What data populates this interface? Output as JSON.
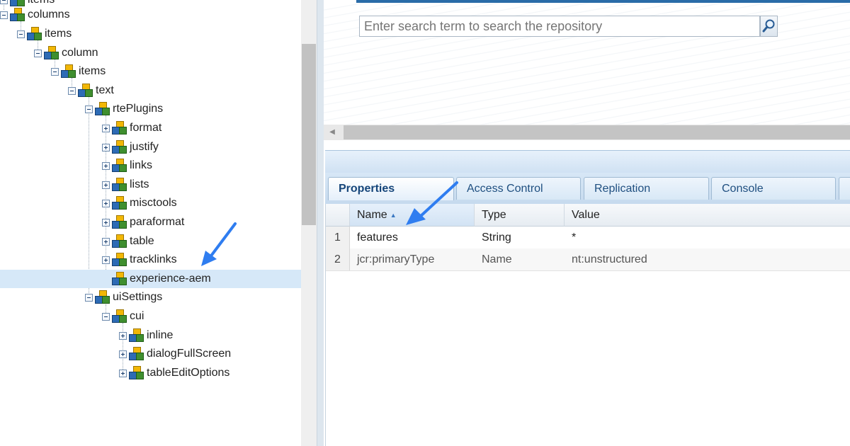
{
  "tree": {
    "nodes": [
      {
        "label": "items",
        "expander": "minus"
      },
      {
        "label": "columns",
        "expander": "minus"
      },
      {
        "label": "items",
        "expander": "minus"
      },
      {
        "label": "column",
        "expander": "minus"
      },
      {
        "label": "items",
        "expander": "minus"
      },
      {
        "label": "text",
        "expander": "minus"
      },
      {
        "label": "rtePlugins",
        "expander": "minus"
      },
      {
        "label": "format",
        "expander": "plus"
      },
      {
        "label": "justify",
        "expander": "plus"
      },
      {
        "label": "links",
        "expander": "plus"
      },
      {
        "label": "lists",
        "expander": "plus"
      },
      {
        "label": "misctools",
        "expander": "plus"
      },
      {
        "label": "paraformat",
        "expander": "plus"
      },
      {
        "label": "table",
        "expander": "plus"
      },
      {
        "label": "tracklinks",
        "expander": "plus"
      },
      {
        "label": "experience-aem",
        "expander": "none",
        "selected": true
      },
      {
        "label": "uiSettings",
        "expander": "minus"
      },
      {
        "label": "cui",
        "expander": "minus"
      },
      {
        "label": "inline",
        "expander": "plus"
      },
      {
        "label": "dialogFullScreen",
        "expander": "plus"
      },
      {
        "label": "tableEditOptions",
        "expander": "plus"
      }
    ]
  },
  "search": {
    "placeholder": "Enter search term to search the repository",
    "icon": "magnifier-icon"
  },
  "tabs": [
    {
      "label": "Properties",
      "active": true
    },
    {
      "label": "Access Control"
    },
    {
      "label": "Replication"
    },
    {
      "label": "Console"
    }
  ],
  "grid": {
    "columns": {
      "name": "Name",
      "type": "Type",
      "value": "Value"
    },
    "sort": "ascending",
    "rows": [
      {
        "num": "1",
        "name": "features",
        "type": "String",
        "value": "*"
      },
      {
        "num": "2",
        "name": "jcr:primaryType",
        "type": "Name",
        "value": "nt:unstructured"
      }
    ]
  },
  "colors": {
    "selection": "#d6e8f8",
    "annotation_arrow": "#2f7df0",
    "tab_text": "#1f4f80"
  }
}
